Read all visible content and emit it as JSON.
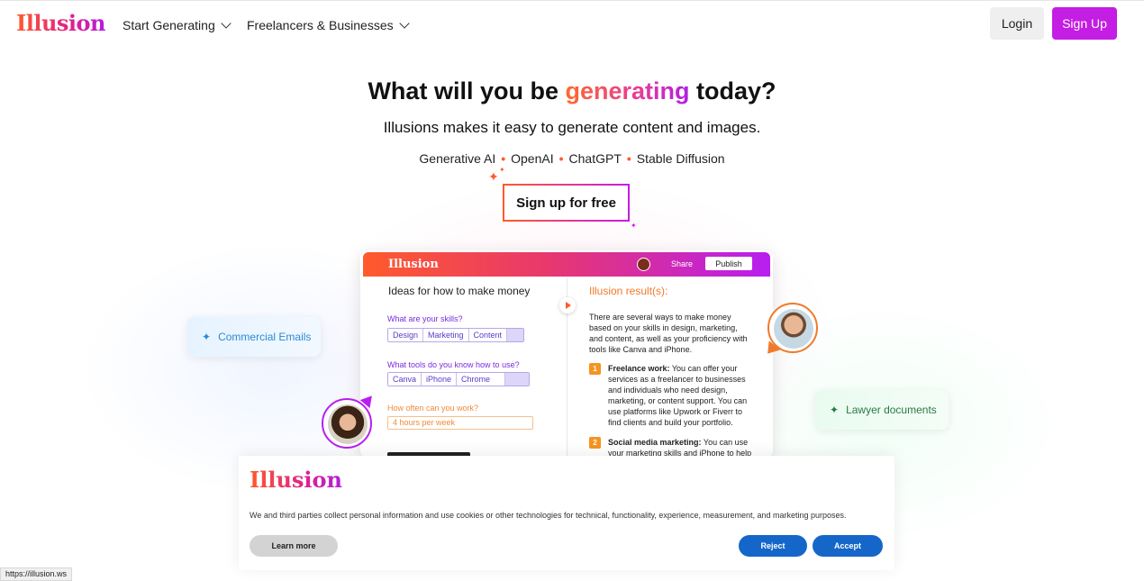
{
  "header": {
    "logo": "Illusion",
    "nav": [
      {
        "label": "Start Generating"
      },
      {
        "label": "Freelancers & Businesses"
      }
    ],
    "login_label": "Login",
    "signup_label": "Sign Up"
  },
  "hero": {
    "title_prefix": "What will you be",
    "title_highlight": "generating",
    "title_suffix": "today?",
    "subtitle": "Illusions makes it easy to generate content and images.",
    "tech": [
      "Generative AI",
      "OpenAI",
      "ChatGPT",
      "Stable Diffusion"
    ],
    "cta_label": "Sign up for free"
  },
  "mockup": {
    "logo": "Illusion",
    "share_label": "Share",
    "publish_label": "Publish",
    "left_title": "Ideas for how to make money",
    "right_title": "Illusion result(s):",
    "q1": "What are your skills?",
    "skills": [
      "Design",
      "Marketing",
      "Content"
    ],
    "q2": "What tools do you know how to use?",
    "tools": [
      "Canva",
      "iPhone",
      "Chrome"
    ],
    "q3": "How often can you work?",
    "hours_value": "4 hours per week",
    "intro": "There are several ways to make money based on your skills in design, marketing, and content, as well as your proficiency with tools like Canva and iPhone.",
    "items": [
      {
        "num": "1",
        "title": "Freelance work:",
        "text": "You can offer your services as a freelancer to businesses and individuals who need design, marketing, or content support. You can use platforms like Upwork or Fiverr to find clients and build your portfolio."
      },
      {
        "num": "2",
        "title": "Social media marketing:",
        "text": "You can use your marketing skills and iPhone to help"
      }
    ]
  },
  "pills": {
    "left": "Commercial Emails",
    "right": "Lawyer documents"
  },
  "cookie": {
    "logo": "Illusion",
    "text": "We and third parties collect personal information and use cookies or other technologies for technical, functionality, experience, measurement, and marketing purposes.",
    "learn_more": "Learn more",
    "reject": "Reject",
    "accept": "Accept"
  },
  "status_url": "https://illusion.ws",
  "colors": {
    "brand_purple": "#c41de4",
    "brand_orange": "#ff5a2c",
    "cookie_blue": "#1566c9"
  }
}
